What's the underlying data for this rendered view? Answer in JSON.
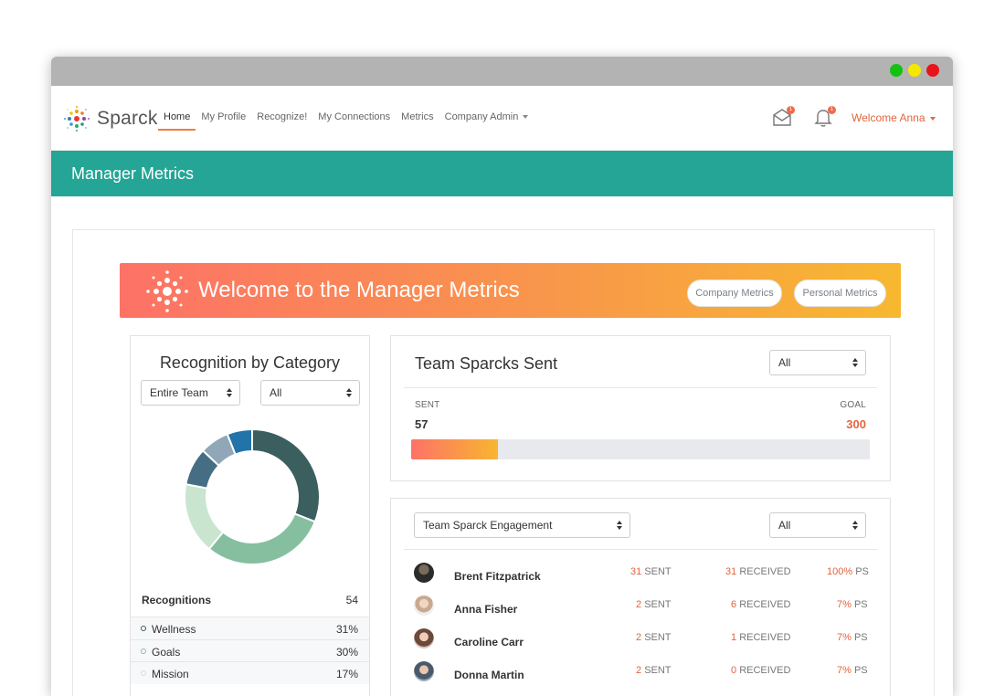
{
  "app": {
    "logo_text": "Sparck",
    "nav": [
      "Home",
      "My Profile",
      "Recognize!",
      "My Connections",
      "Metrics",
      "Company Admin"
    ],
    "mail_badge": "1",
    "bell_badge": "1",
    "welcome": "Welcome Anna"
  },
  "page": {
    "header": "Manager Metrics",
    "banner_title": "Welcome to the Manager Metrics",
    "company_metrics": "Company Metrics",
    "personal_metrics": "Personal Metrics"
  },
  "recognition": {
    "title": "Recognition by Category",
    "team_select": "Entire Team",
    "filter_select": "All",
    "total_label": "Recognitions",
    "total_value": "54",
    "categories": [
      {
        "name": "Wellness",
        "pct": "31%",
        "color": "#3b5f5f"
      },
      {
        "name": "Goals",
        "pct": "30%",
        "color": "#86bfa0"
      },
      {
        "name": "Mission",
        "pct": "17%",
        "color": "#c9e5d0"
      }
    ]
  },
  "chart_data": {
    "type": "pie",
    "donut": true,
    "segments": [
      {
        "value": 31,
        "color": "#3b5f5f"
      },
      {
        "value": 30,
        "color": "#86bfa0"
      },
      {
        "value": 17,
        "color": "#c9e5d0"
      },
      {
        "value": 9,
        "color": "#456e84"
      },
      {
        "value": 7,
        "color": "#8fa7b7"
      },
      {
        "value": 6,
        "color": "#2273a9"
      }
    ]
  },
  "sent": {
    "title": "Team Sparcks Sent",
    "filter": "All",
    "sent_label": "SENT",
    "sent_value": "57",
    "goal_label": "GOAL",
    "goal_value": "300",
    "progress_fraction": 0.19
  },
  "engagement": {
    "select": "Team Sparck Engagement",
    "filter": "All",
    "rows": [
      {
        "name": "Brent Fitzpatrick",
        "sent": "31",
        "received": "31",
        "ps": "100%"
      },
      {
        "name": "Anna Fisher",
        "sent": "2",
        "received": "6",
        "ps": "7%"
      },
      {
        "name": "Caroline Carr",
        "sent": "2",
        "received": "1",
        "ps": "7%"
      },
      {
        "name": "Donna Martin",
        "sent": "2",
        "received": "0",
        "ps": "7%"
      }
    ],
    "sent_unit": "SENT",
    "received_unit": "RECEIVED",
    "ps_unit": "PS"
  }
}
